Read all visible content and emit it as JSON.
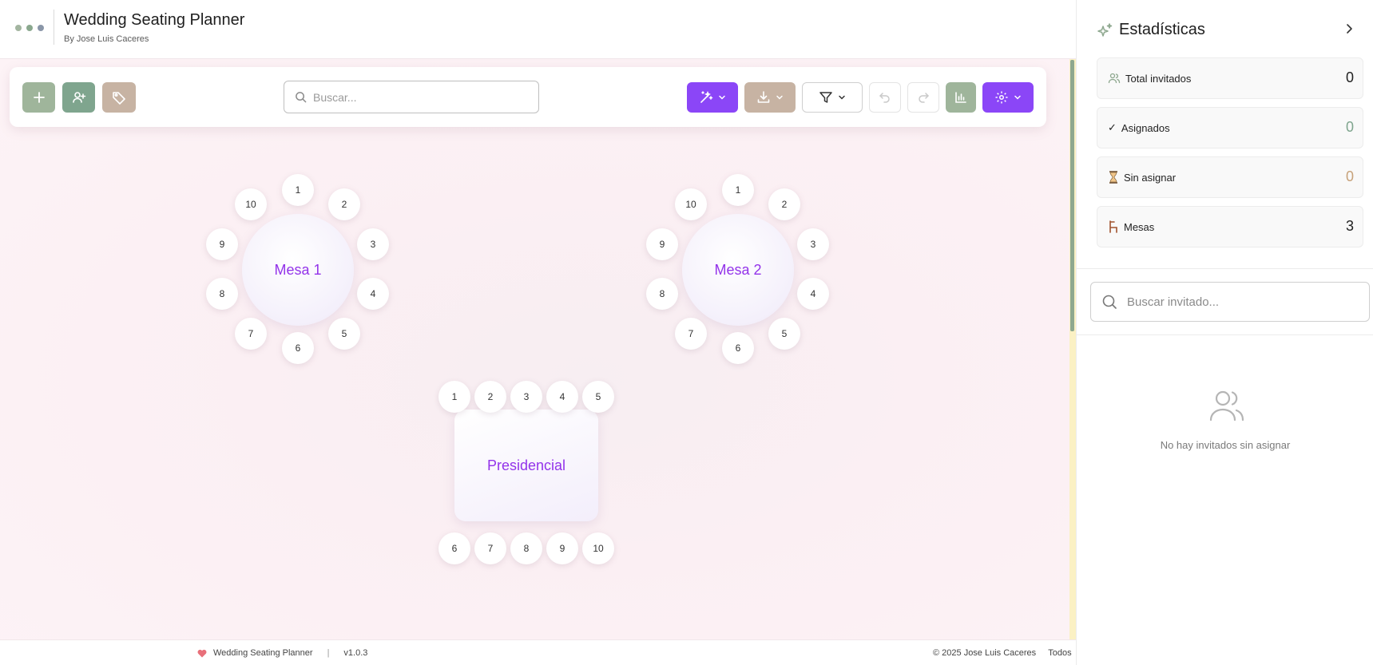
{
  "app": {
    "title": "Wedding Seating Planner",
    "author": "By Jose Luis Caceres",
    "dot_colors": [
      "#a3b5a0",
      "#8aa88e",
      "#8a96a8"
    ]
  },
  "toolbar": {
    "search_placeholder": "Buscar...",
    "buttons": [
      {
        "name": "add-table-button",
        "icon": "plus-icon",
        "color": "#9fb59b"
      },
      {
        "name": "add-guest-button",
        "icon": "user-plus-icon",
        "color": "#7fa58e"
      },
      {
        "name": "tags-button",
        "icon": "tag-icon",
        "color": "#c7b3a3"
      },
      {
        "name": "auto-assign-button",
        "icon": "magic-wand-icon",
        "color": "#8b46f7"
      },
      {
        "name": "export-button",
        "icon": "download-icon",
        "color": "#c7b3a3"
      },
      {
        "name": "filter-button",
        "icon": "filter-icon",
        "color": "#ffffff"
      },
      {
        "name": "undo-button",
        "icon": "undo-icon"
      },
      {
        "name": "redo-button",
        "icon": "redo-icon"
      },
      {
        "name": "stats-button",
        "icon": "bar-chart-icon",
        "color": "#9fb59b"
      },
      {
        "name": "settings-button",
        "icon": "gear-icon",
        "color": "#8b46f7"
      }
    ]
  },
  "tables": [
    {
      "name": "Mesa 1",
      "shape": "round",
      "seats": [
        "1",
        "2",
        "3",
        "4",
        "5",
        "6",
        "7",
        "8",
        "9",
        "10"
      ]
    },
    {
      "name": "Mesa 2",
      "shape": "round",
      "seats": [
        "1",
        "2",
        "3",
        "4",
        "5",
        "6",
        "7",
        "8",
        "9",
        "10"
      ]
    },
    {
      "name": "Presidencial",
      "shape": "rectangular",
      "seats": [
        "1",
        "2",
        "3",
        "4",
        "5",
        "6",
        "7",
        "8",
        "9",
        "10"
      ]
    }
  ],
  "footer": {
    "app_name": "Wedding Seating Planner",
    "version": "v1.0.3",
    "copyright": "© 2025 Jose Luis Caceres",
    "rights": "Todos"
  },
  "stats_panel": {
    "title": "Estadísticas",
    "items": [
      {
        "label": "Total invitados",
        "value": "0",
        "icon": "users-icon",
        "value_color": "#222222"
      },
      {
        "label": "Asignados",
        "value": "0",
        "icon": "check-icon",
        "value_color": "#7fa58e"
      },
      {
        "label": "Sin asignar",
        "value": "0",
        "icon": "hourglass-icon",
        "value_color": "#c7a27a"
      },
      {
        "label": "Mesas",
        "value": "3",
        "icon": "chair-icon",
        "value_color": "#222222"
      }
    ],
    "guest_search_placeholder": "Buscar invitado...",
    "empty_message": "No hay invitados sin asignar"
  }
}
